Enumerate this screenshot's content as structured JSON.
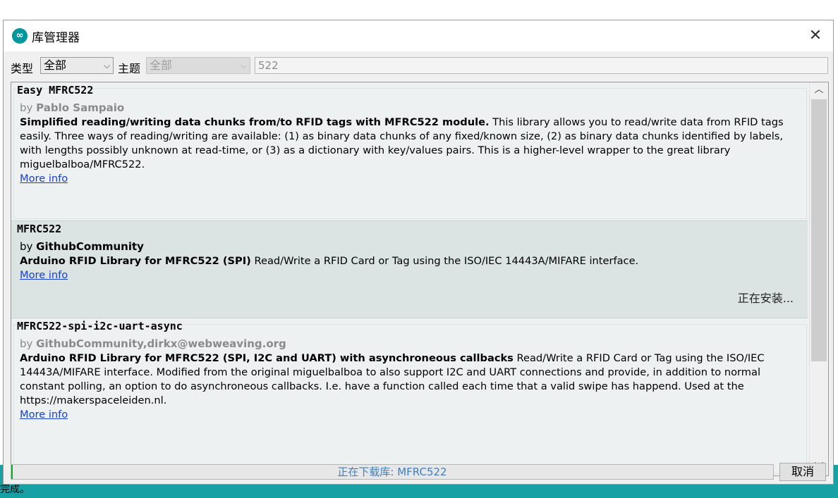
{
  "dialog": {
    "title": "库管理器",
    "close_label": "✕"
  },
  "filters": {
    "type_label": "类型",
    "type_value": "全部",
    "topic_label": "主题",
    "topic_value": "全部",
    "search_value": "522"
  },
  "libraries": [
    {
      "name": "Easy MFRC522",
      "by_prefix": "by ",
      "author": "Pablo Sampaio",
      "desc_bold": "Simplified reading/writing data chunks from/to RFID tags with MFRC522 module.",
      "desc_rest": " This library allows you to read/write data from RFID tags easily. Three ways of reading/writing are available: (1) as binary data chunks of any fixed/known size, (2) as binary data chunks identified by labels, with lengths possibly unknown at read-time, or (3) as a dictionary with key/values pairs. This is a higher-level wrapper to the great library miguelbalboa/MFRC522.",
      "more_info": "More info",
      "status": ""
    },
    {
      "name": "MFRC522",
      "by_prefix": "by ",
      "author": "GithubCommunity",
      "desc_bold": "Arduino RFID Library for MFRC522 (SPI)",
      "desc_rest": " Read/Write a RFID Card or Tag using the ISO/IEC 14443A/MIFARE interface.",
      "more_info": "More info",
      "status": "正在安装..."
    },
    {
      "name": "MFRC522-spi-i2c-uart-async",
      "by_prefix": "by ",
      "author": "GithubCommunity,dirkx@webweaving.org",
      "desc_bold": "Arduino RFID Library for MFRC522 (SPI, I2C and UART) with asynchroneous callbacks",
      "desc_rest": " Read/Write a RFID Card or Tag using the ISO/IEC 14443A/MIFARE interface. Modified from the original miguelbalboa to also support I2C and UART connections and provide, in addition to normal constant polling, an option to do asynchroneous callbacks. I.e. have a function called each time that a valid swipe has happend. Used at the https://makerspaceleiden.nl.",
      "more_info": "More info",
      "status": ""
    }
  ],
  "footer": {
    "progress_text": "正在下载库: MFRC522",
    "progress_fraction": 0.002,
    "cancel_label": "取消"
  },
  "background": {
    "status_text": "完成。"
  },
  "colors": {
    "accent": "#00979d",
    "link": "#1a3fc9",
    "progress": "#06b025"
  }
}
